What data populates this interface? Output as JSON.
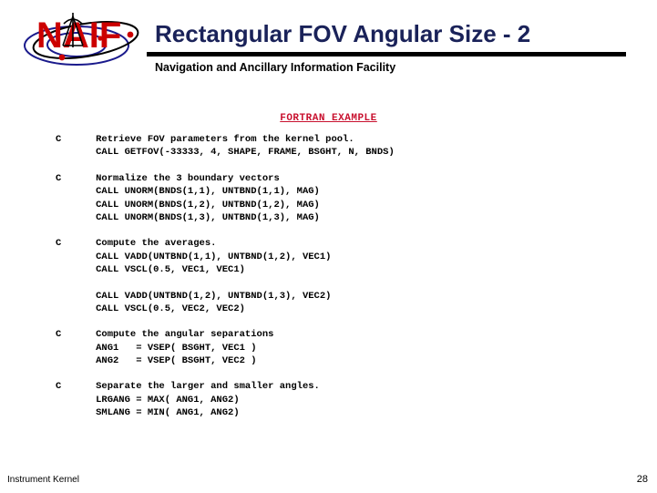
{
  "header": {
    "logo_text": "NAIF",
    "logo_name": "naif-logo",
    "title": "Rectangular FOV Angular Size - 2",
    "subtitle": "Navigation and Ancillary Information Facility",
    "title_color": "#1a2259",
    "rule_color": "#000000"
  },
  "section": {
    "heading": "FORTRAN EXAMPLE",
    "heading_color": "#c8102e"
  },
  "code": {
    "groups": [
      {
        "lines": [
          "C      Retrieve FOV parameters from the kernel pool.",
          "       CALL GETFOV(-33333, 4, SHAPE, FRAME, BSGHT, N, BNDS)"
        ]
      },
      {
        "lines": [
          "C      Normalize the 3 boundary vectors",
          "       CALL UNORM(BNDS(1,1), UNTBND(1,1), MAG)",
          "       CALL UNORM(BNDS(1,2), UNTBND(1,2), MAG)",
          "       CALL UNORM(BNDS(1,3), UNTBND(1,3), MAG)"
        ]
      },
      {
        "lines": [
          "C      Compute the averages.",
          "       CALL VADD(UNTBND(1,1), UNTBND(1,2), VEC1)",
          "       CALL VSCL(0.5, VEC1, VEC1)"
        ]
      },
      {
        "lines": [
          "       CALL VADD(UNTBND(1,2), UNTBND(1,3), VEC2)",
          "       CALL VSCL(0.5, VEC2, VEC2)"
        ]
      },
      {
        "lines": [
          "C      Compute the angular separations",
          "       ANG1   = VSEP( BSGHT, VEC1 )",
          "       ANG2   = VSEP( BSGHT, VEC2 )"
        ]
      },
      {
        "lines": [
          "C      Separate the larger and smaller angles.",
          "       LRGANG = MAX( ANG1, ANG2)",
          "       SMLANG = MIN( ANG1, ANG2)"
        ]
      }
    ]
  },
  "footer": {
    "left_label": "Instrument Kernel",
    "page_number": "28"
  }
}
